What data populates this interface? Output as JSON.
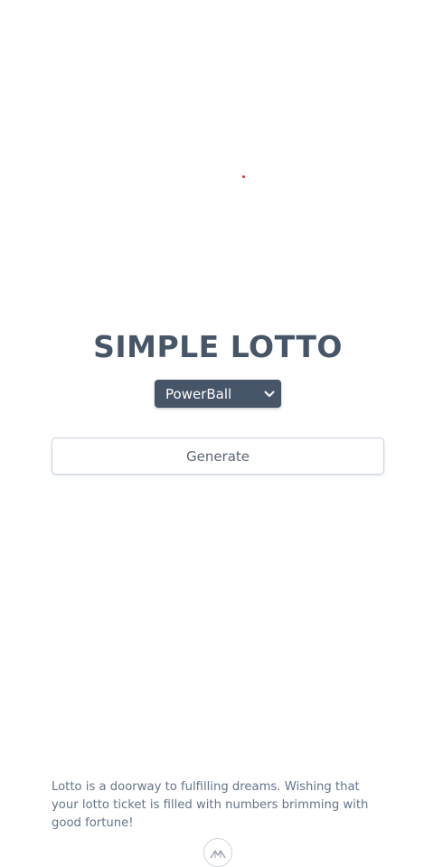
{
  "colors": {
    "title": "#475569",
    "select_background": "#475569",
    "dot": "#dc2626"
  },
  "header": {
    "title": "SIMPLE LOTTO"
  },
  "game_select": {
    "selected": "PowerBall",
    "icon": "chevron-down-icon"
  },
  "actions": {
    "generate_label": "Generate"
  },
  "footer": {
    "message": "Lotto is a doorway to fulfilling dreams. Wishing that your lotto ticket is filled with numbers brimming with good fortune!",
    "logo_icon": "mountain-logo-icon"
  }
}
